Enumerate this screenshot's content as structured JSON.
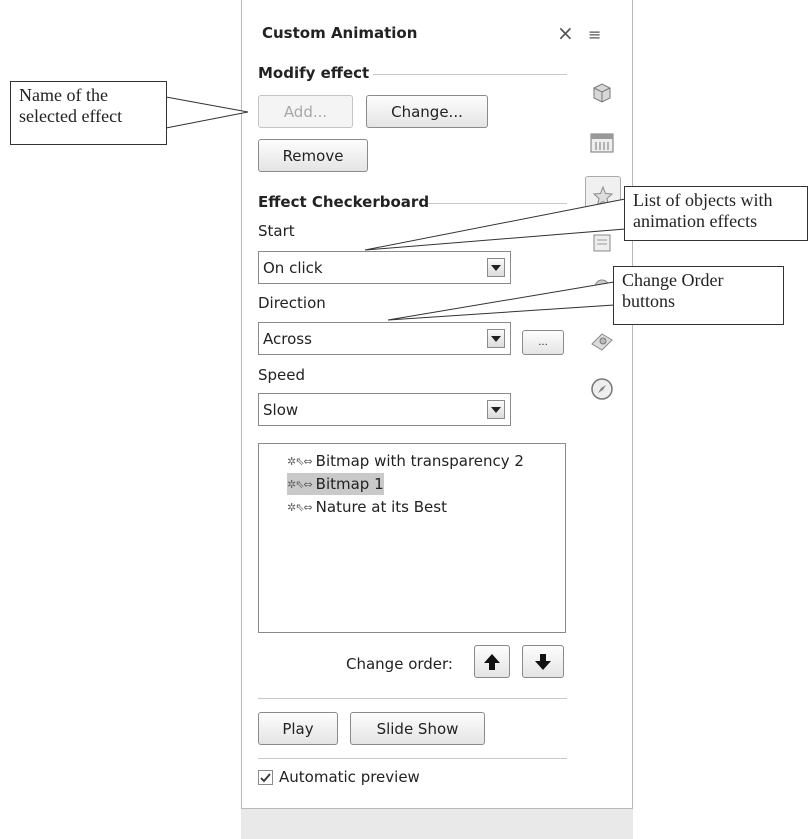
{
  "panel": {
    "title": "Custom Animation",
    "close_glyph": "×",
    "menu_glyph": "≡",
    "modify_effect": {
      "heading": "Modify effect",
      "add_label": "Add...",
      "change_label": "Change...",
      "remove_label": "Remove"
    },
    "effect": {
      "heading": "Effect Checkerboard",
      "start_label": "Start",
      "start_value": "On click",
      "direction_label": "Direction",
      "direction_value": "Across",
      "options_button": "...",
      "speed_label": "Speed",
      "speed_value": "Slow"
    },
    "objects": [
      {
        "label": "Bitmap with transparency 2",
        "selected": false
      },
      {
        "label": "Bitmap 1",
        "selected": true
      },
      {
        "label": "Nature at its Best",
        "selected": false
      }
    ],
    "change_order_label": "Change order:",
    "play_label": "Play",
    "slideshow_label": "Slide Show",
    "automatic_preview_label": "Automatic preview",
    "automatic_preview_checked": true
  },
  "sidebar_icons": [
    "gallery-icon",
    "table-design-icon",
    "custom-animation-icon",
    "slide-transition-icon",
    "styles-icon",
    "master-pages-icon",
    "navigator-icon"
  ],
  "callouts": {
    "name_effect": "Name of the selected effect",
    "list_objects": "List of objects with animation effects",
    "change_order": "Change Order buttons"
  }
}
